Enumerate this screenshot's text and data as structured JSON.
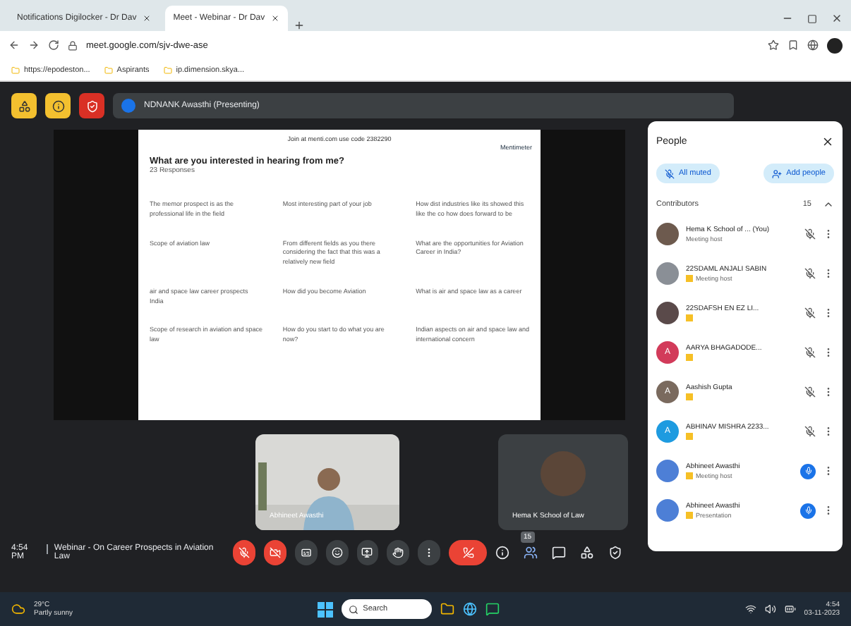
{
  "browser": {
    "tabs": [
      {
        "label": "Notifications Digilocker - Dr Dav",
        "selected": false
      },
      {
        "label": "Meet - Webinar - Dr Dav",
        "selected": true
      }
    ],
    "url": "meet.google.com/sjv-dwe-ase",
    "bookmarks": [
      "https://epodeston...",
      "Aspirants",
      "ip.dimension.skya..."
    ]
  },
  "meet": {
    "presenting": "NDNANK Awasthi (Presenting)",
    "slide": {
      "header": "Join at menti.com  use code 2382290",
      "brand": "Mentimeter",
      "question": "What are you interested in hearing from me?",
      "responses": "23 Responses",
      "answers": [
        "The memor prospect is as the professional life in the field",
        "Most interesting part of your job",
        "How dist industries like its showed this like the co how does forward to be",
        "Scope of aviation law",
        "From different fields as you there considering the fact that this was a relatively new field",
        "What are the opportunities for Aviation Career in India?",
        "air and space law career prospects India",
        "How did you become Aviation",
        "What is air and space law as a career",
        "Scope of research in aviation and space law",
        "How do you start to do what you are now?",
        "Indian aspects on air and space law and international concern"
      ]
    },
    "tiles": [
      {
        "kind": "video",
        "name": "Abhineet Awasthi"
      },
      {
        "kind": "avatar",
        "name": "Hema K School of Law"
      }
    ],
    "time": "4:54 PM",
    "meeting": "Webinar - On Career Prospects in Aviation Law",
    "controls": [
      {
        "kind": "mic",
        "off": true
      },
      {
        "kind": "camera",
        "off": true
      },
      {
        "kind": "captions",
        "off": false
      },
      {
        "kind": "emoji",
        "off": false
      },
      {
        "kind": "present",
        "off": false
      },
      {
        "kind": "hand",
        "off": false
      },
      {
        "kind": "more",
        "off": false
      },
      {
        "kind": "end",
        "off": true
      }
    ],
    "count": "15"
  },
  "people": {
    "title": "People",
    "mute_all": "All muted",
    "add": "Add people",
    "section": "Contributors",
    "section_count": "15",
    "participants": [
      {
        "name": "Hema K School of ... (You)",
        "sub": "Meeting host",
        "color": "#6d5a4e",
        "badge": false,
        "muted": true
      },
      {
        "name": "22SDAML ANJALI SABIN",
        "sub": "Meeting host",
        "color": "#8a8f96",
        "badge": true,
        "muted": true
      },
      {
        "name": "22SDAFSH EN EZ LI...",
        "color": "#5a4a4a",
        "badge": true,
        "muted": true
      },
      {
        "name": "AARYA BHAGADODE...",
        "color": "#d23b5a",
        "initial": "A",
        "badge": true,
        "muted": true
      },
      {
        "name": "Aashish Gupta",
        "color": "#7a6a5e",
        "initial": "A",
        "badge": true,
        "muted": true
      },
      {
        "name": "ABHINAV MISHRA 2233...",
        "color": "#1e9be0",
        "initial": "A",
        "badge": true,
        "muted": true
      },
      {
        "name": "Abhineet Awasthi",
        "sub": "Meeting host",
        "color": "#4d7fd6",
        "badge": true,
        "muted": false
      },
      {
        "name": "Abhineet Awasthi",
        "sub": "Presentation",
        "color": "#4d7fd6",
        "badge": true,
        "muted": false
      }
    ]
  },
  "taskbar": {
    "weather": "29°C",
    "weather_sub": "Partly sunny",
    "search": "Search",
    "clock": "4:54",
    "date": "03-11-2023"
  }
}
